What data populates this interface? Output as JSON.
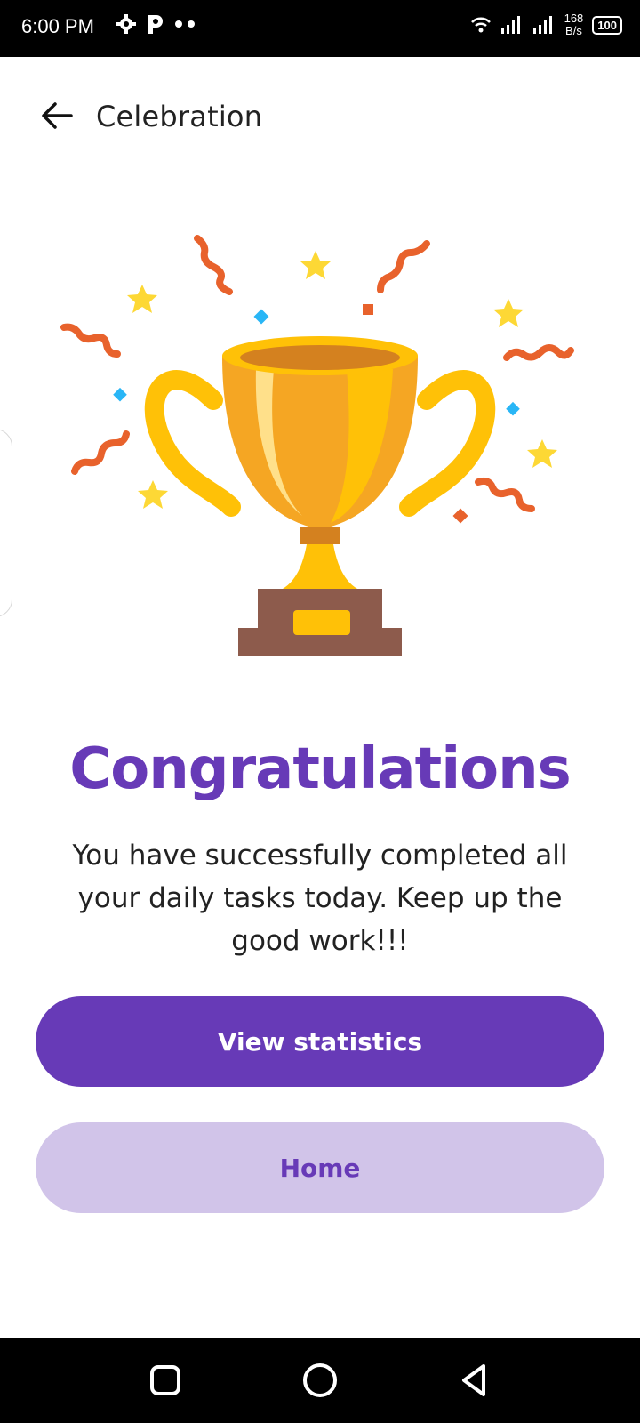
{
  "status_bar": {
    "time": "6:00 PM",
    "net_speed_value": "168",
    "net_speed_unit": "B/s",
    "battery": "100",
    "icons": [
      "settings-icon",
      "p-notification-icon",
      "more-dots-icon",
      "wifi-icon",
      "signal-icon",
      "signal-icon-2",
      "battery-icon"
    ]
  },
  "app_bar": {
    "title": "Celebration",
    "back_icon": "arrow-left-icon"
  },
  "illustration": {
    "name": "trophy-confetti",
    "colors": {
      "trophy": "#ffc107",
      "trophy_dark": "#f5a623",
      "base": "#8d5b4c",
      "confetti_orange": "#e8622c",
      "confetti_blue": "#29b6f6",
      "star": "#fdd835"
    }
  },
  "content": {
    "headline": "Congratulations",
    "message": "You have successfully completed all your daily tasks today. Keep up the good work!!!"
  },
  "buttons": {
    "primary_label": "View statistics",
    "secondary_label": "Home"
  },
  "nav_bar": {
    "icons": [
      "recent-apps-icon",
      "home-icon",
      "back-triangle-icon"
    ]
  },
  "theme": {
    "accent": "#673ab7",
    "accent_light": "#d1c4e9"
  }
}
